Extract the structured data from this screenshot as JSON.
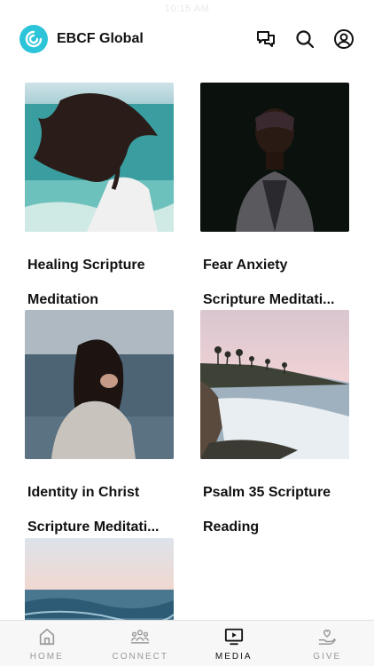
{
  "status_bar": {
    "time": "10:15 AM"
  },
  "header": {
    "app_name": "EBCF Global",
    "logo_icon": "ebcf-logo-icon",
    "actions": [
      "chat-icon",
      "search-icon",
      "account-icon"
    ],
    "accent_color": "#2cc4d8"
  },
  "media": {
    "items": [
      {
        "title_line1": "Healing Scripture",
        "title_line2": "Meditation",
        "image": "woman-windblown-hair-ocean"
      },
      {
        "title_line1": "Fear Anxiety",
        "title_line2": "Scripture Meditati...",
        "image": "woman-dark-portrait"
      },
      {
        "title_line1": "Identity in Christ",
        "title_line2": "Scripture Meditati...",
        "image": "woman-by-the-sea"
      },
      {
        "title_line1": "Psalm 35 Scripture",
        "title_line2": "Reading",
        "image": "coastline-palm-trees"
      },
      {
        "title_line1": "",
        "title_line2": "",
        "image": "ocean-waves-pink-sky"
      }
    ]
  },
  "tabs": [
    {
      "label": "HOME",
      "icon": "home-icon",
      "active": false
    },
    {
      "label": "CONNECT",
      "icon": "people-icon",
      "active": false
    },
    {
      "label": "MEDIA",
      "icon": "media-play-icon",
      "active": true
    },
    {
      "label": "GIVE",
      "icon": "heart-hand-icon",
      "active": false
    }
  ]
}
